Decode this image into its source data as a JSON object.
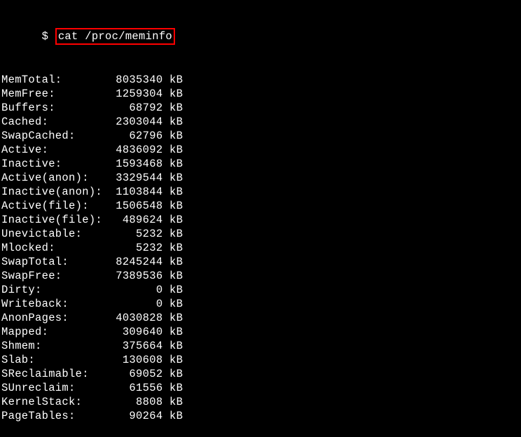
{
  "prompt": {
    "symbol": "$ ",
    "command": "cat /proc/meminfo"
  },
  "meminfo": [
    {
      "label": "MemTotal:",
      "value": "8035340",
      "unit": "kB"
    },
    {
      "label": "MemFree:",
      "value": "1259304",
      "unit": "kB"
    },
    {
      "label": "Buffers:",
      "value": "68792",
      "unit": "kB"
    },
    {
      "label": "Cached:",
      "value": "2303044",
      "unit": "kB"
    },
    {
      "label": "SwapCached:",
      "value": "62796",
      "unit": "kB"
    },
    {
      "label": "Active:",
      "value": "4836092",
      "unit": "kB"
    },
    {
      "label": "Inactive:",
      "value": "1593468",
      "unit": "kB"
    },
    {
      "label": "Active(anon):",
      "value": "3329544",
      "unit": "kB"
    },
    {
      "label": "Inactive(anon):",
      "value": "1103844",
      "unit": "kB"
    },
    {
      "label": "Active(file):",
      "value": "1506548",
      "unit": "kB"
    },
    {
      "label": "Inactive(file):",
      "value": "489624",
      "unit": "kB"
    },
    {
      "label": "Unevictable:",
      "value": "5232",
      "unit": "kB"
    },
    {
      "label": "Mlocked:",
      "value": "5232",
      "unit": "kB"
    },
    {
      "label": "SwapTotal:",
      "value": "8245244",
      "unit": "kB"
    },
    {
      "label": "SwapFree:",
      "value": "7389536",
      "unit": "kB"
    },
    {
      "label": "Dirty:",
      "value": "0",
      "unit": "kB"
    },
    {
      "label": "Writeback:",
      "value": "0",
      "unit": "kB"
    },
    {
      "label": "AnonPages:",
      "value": "4030828",
      "unit": "kB"
    },
    {
      "label": "Mapped:",
      "value": "309640",
      "unit": "kB"
    },
    {
      "label": "Shmem:",
      "value": "375664",
      "unit": "kB"
    },
    {
      "label": "Slab:",
      "value": "130608",
      "unit": "kB"
    },
    {
      "label": "SReclaimable:",
      "value": "69052",
      "unit": "kB"
    },
    {
      "label": "SUnreclaim:",
      "value": "61556",
      "unit": "kB"
    },
    {
      "label": "KernelStack:",
      "value": "8808",
      "unit": "kB"
    },
    {
      "label": "PageTables:",
      "value": "90264",
      "unit": "kB"
    }
  ]
}
